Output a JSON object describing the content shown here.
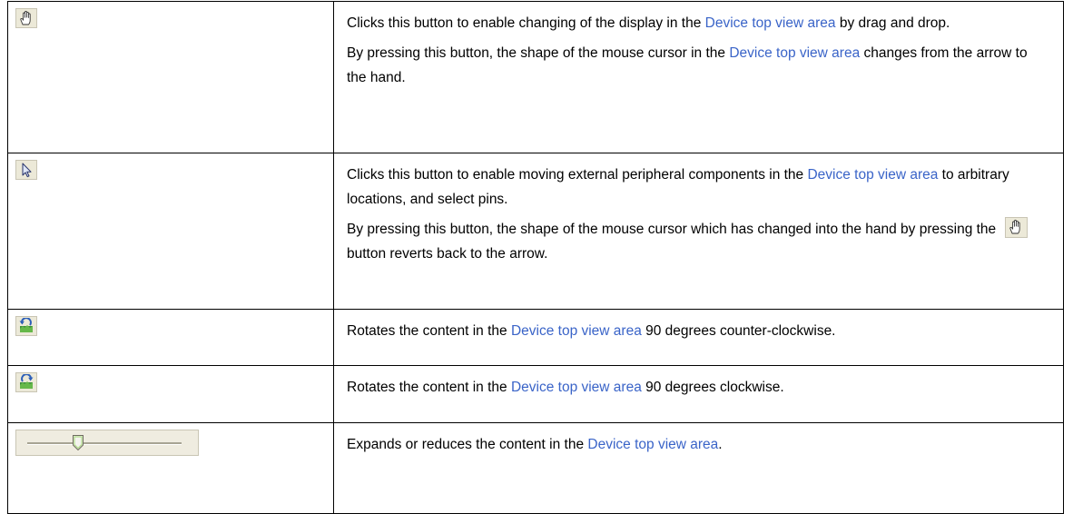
{
  "rows": [
    {
      "icon": "hand-pan-icon",
      "description": [
        {
          "parts": [
            {
              "text": "Clicks this button to enable changing of the display in the "
            },
            {
              "text": "Device top view area",
              "link": true
            },
            {
              "text": " by drag and drop."
            }
          ]
        },
        {
          "parts": [
            {
              "text": "By pressing this button, the shape of the mouse cursor in the "
            },
            {
              "text": "Device top view area",
              "link": true
            },
            {
              "text": " changes from the arrow to the hand."
            }
          ]
        }
      ]
    },
    {
      "icon": "arrow-select-icon",
      "description": [
        {
          "parts": [
            {
              "text": "Clicks this button to enable moving external peripheral components in the "
            },
            {
              "text": "Device top view area",
              "link": true
            },
            {
              "text": " to arbitrary locations, and select pins."
            }
          ]
        },
        {
          "parts": [
            {
              "text": "By pressing this button, the shape of the mouse cursor which has changed into the hand by pressing the "
            },
            {
              "icon": "hand-pan-icon"
            },
            {
              "text": " button reverts back to the arrow."
            }
          ]
        }
      ]
    },
    {
      "icon": "rotate-counter-clockwise-icon",
      "description": [
        {
          "parts": [
            {
              "text": "Rotates the content in the "
            },
            {
              "text": "Device top view area",
              "link": true
            },
            {
              "text": " 90 degrees counter-clockwise."
            }
          ]
        }
      ]
    },
    {
      "icon": "rotate-clockwise-icon",
      "description": [
        {
          "parts": [
            {
              "text": "Rotates the content in the "
            },
            {
              "text": "Device top view area",
              "link": true
            },
            {
              "text": " 90 degrees clockwise."
            }
          ]
        }
      ]
    },
    {
      "icon": "zoom-slider",
      "slider_level": 0.33,
      "description": [
        {
          "parts": [
            {
              "text": "Expands or reduces the content in the "
            },
            {
              "text": "Device top view area",
              "link": true
            },
            {
              "text": "."
            }
          ]
        }
      ]
    }
  ],
  "colors": {
    "link": "#3a64c8",
    "border": "#000000",
    "button_face": "#ece9d8"
  }
}
